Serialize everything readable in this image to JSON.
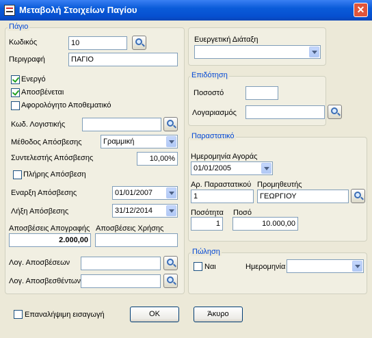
{
  "window": {
    "title": "Μεταβολή Στοιχείων Παγίου",
    "close_glyph": "✕"
  },
  "asset": {
    "legend": "Πάγιο",
    "code_label": "Κωδικός",
    "code_value": "10",
    "desc_label": "Περιγραφή",
    "desc_value": "ΠΑΓΙΟ",
    "active_label": "Ενεργό",
    "active_checked": true,
    "depreciable_label": "Αποσβένεται",
    "depreciable_checked": true,
    "taxfree_label": "Αφορολόγητο Αποθεματικό",
    "taxfree_checked": false,
    "accounting_code_label": "Κωδ. Λογιστικής",
    "accounting_code_value": "",
    "method_label": "Μέθοδος Απόσβεσης",
    "method_value": "Γραμμική",
    "coef_label": "Συντελεστής Απόσβεσης",
    "coef_value": "10,00%",
    "full_label": "Πλήρης Απόσβεση",
    "full_checked": false,
    "start_label": "Εναρξη Απόσβεσης",
    "start_value": "01/01/2007",
    "end_label": "Λήξη Απόσβεσης",
    "end_value": "31/12/2014",
    "inventory_dep_label": "Αποσβέσεις Απογραφής",
    "inventory_dep_value": "2.000,00",
    "period_dep_label": "Αποσβέσεις Χρήσης",
    "period_dep_value": "",
    "dep_account_label": "Λογ. Αποσβέσεων",
    "dep_account_value": "",
    "depd_account_label": "Λογ. Αποσβεσθέντων",
    "depd_account_value": ""
  },
  "benefit": {
    "label": "Ευεργετική Διάταξη",
    "value": ""
  },
  "subsidy": {
    "legend": "Επιδότηση",
    "percent_label": "Ποσοστό",
    "percent_value": "",
    "account_label": "Λογαριασμός",
    "account_value": ""
  },
  "document": {
    "legend": "Παραστατικό",
    "purchase_date_label": "Ημερομηνία Αγοράς",
    "purchase_date_value": "01/01/2005",
    "doc_no_label": "Αρ. Παραστατικού",
    "doc_no_value": "1",
    "supplier_label": "Προμηθευτής",
    "supplier_value": "ΓΕΩΡΓΙΟΥ",
    "qty_label": "Ποσότητα",
    "qty_value": "1",
    "amount_label": "Ποσό",
    "amount_value": "10.000,00"
  },
  "sale": {
    "legend": "Πώληση",
    "yes_label": "Ναι",
    "yes_checked": false,
    "date_label": "Ημερομηνία",
    "date_value": ""
  },
  "footer": {
    "repeat_label": "Επαναλήψιμη εισαγωγή",
    "repeat_checked": false,
    "ok_label": "ΟΚ",
    "cancel_label": "Άκυρο"
  },
  "icons": {
    "lookup": "search-icon",
    "dropdown": "chevron-down-icon"
  }
}
